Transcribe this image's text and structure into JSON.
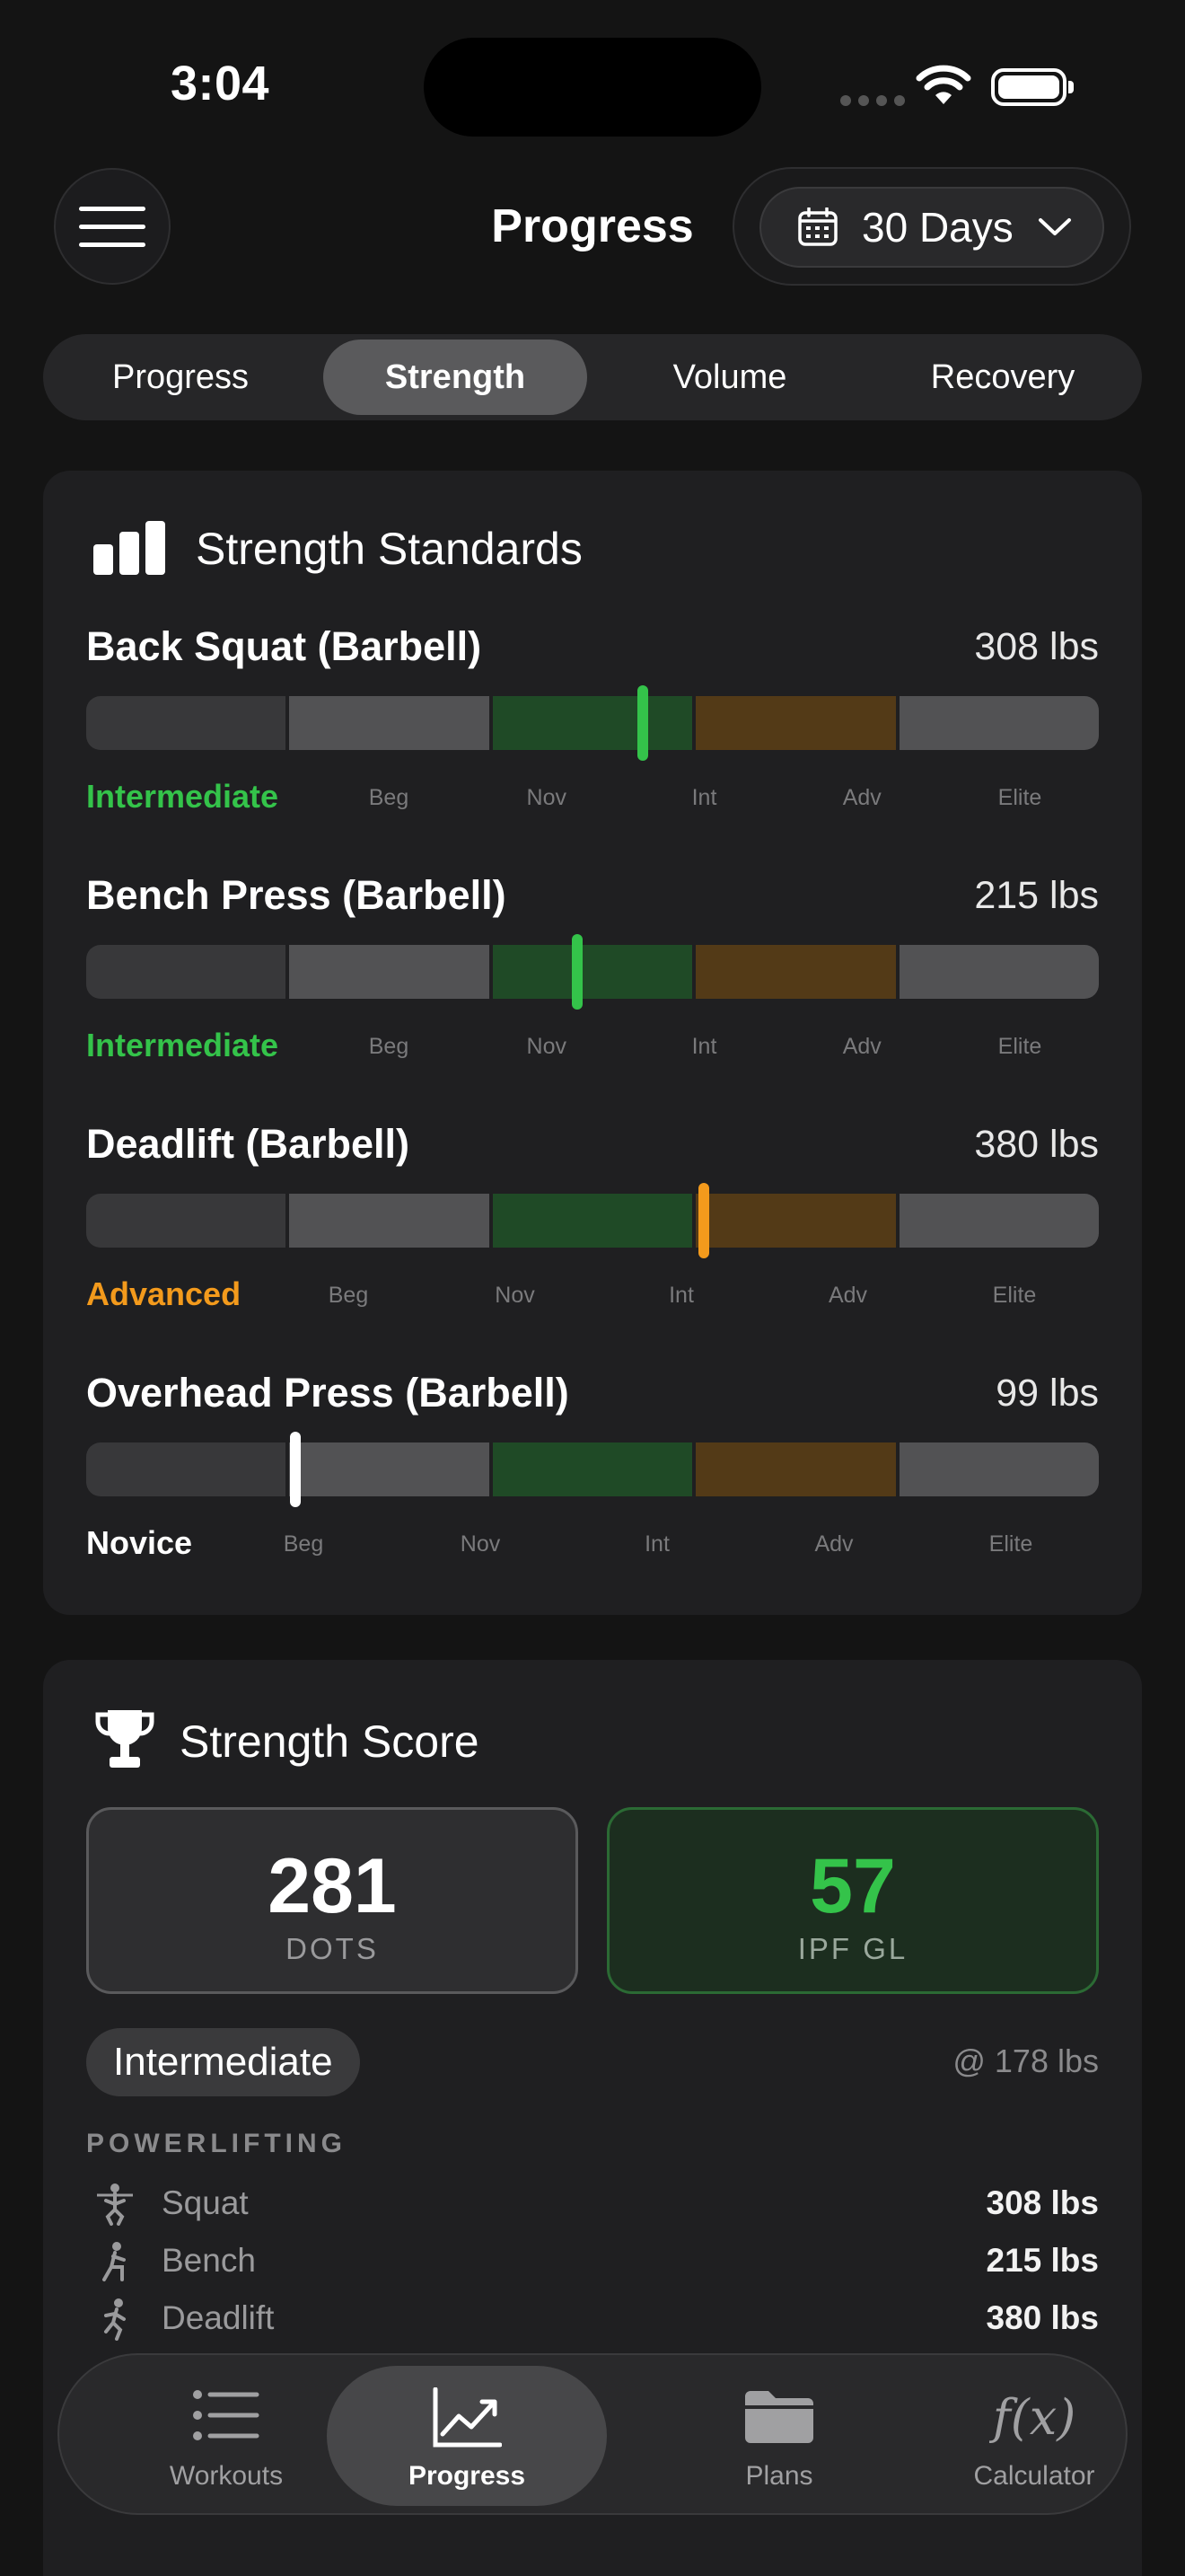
{
  "status": {
    "time": "3:04"
  },
  "header": {
    "title": "Progress",
    "range_label": "30 Days"
  },
  "segments": [
    {
      "label": "Progress",
      "active": false
    },
    {
      "label": "Strength",
      "active": true
    },
    {
      "label": "Volume",
      "active": false
    },
    {
      "label": "Recovery",
      "active": false
    }
  ],
  "standards": {
    "title": "Strength Standards",
    "lifts": [
      {
        "name": "Back Squat (Barbell)",
        "weight": "308 lbs",
        "level": "Intermediate",
        "level_color": "#34c34a",
        "marker_color": "#34c34a",
        "marker_position": 0.55,
        "ticks": [
          "Beg",
          "Nov",
          "Int",
          "Adv",
          "Elite"
        ]
      },
      {
        "name": "Bench Press (Barbell)",
        "weight": "215 lbs",
        "level": "Intermediate",
        "level_color": "#34c34a",
        "marker_color": "#34c34a",
        "marker_position": 0.485,
        "ticks": [
          "Beg",
          "Nov",
          "Int",
          "Adv",
          "Elite"
        ]
      },
      {
        "name": "Deadlift (Barbell)",
        "weight": "380 lbs",
        "level": "Advanced",
        "level_color": "#f39a1c",
        "marker_color": "#f39a1c",
        "marker_position": 0.61,
        "ticks": [
          "Beg",
          "Nov",
          "Int",
          "Adv",
          "Elite"
        ]
      },
      {
        "name": "Overhead Press (Barbell)",
        "weight": "99 lbs",
        "level": "Novice",
        "level_color": "#ffffff",
        "marker_color": "#ffffff",
        "marker_position": 0.207,
        "ticks": [
          "Beg",
          "Nov",
          "Int",
          "Adv",
          "Elite"
        ]
      }
    ],
    "segment_colors": [
      "#38383a",
      "#525254",
      "#1f4a26",
      "#533a17",
      "#525254"
    ]
  },
  "score": {
    "title": "Strength Score",
    "dots_value": "281",
    "dots_label": "DOTS",
    "ipf_value": "57",
    "ipf_label": "IPF GL",
    "classification": "Intermediate",
    "bodyweight": "@ 178 lbs",
    "section_label": "POWERLIFTING",
    "lifts": [
      {
        "name": "Squat",
        "value": "308 lbs",
        "icon": "squat-icon"
      },
      {
        "name": "Bench",
        "value": "215 lbs",
        "icon": "bench-icon"
      },
      {
        "name": "Deadlift",
        "value": "380 lbs",
        "icon": "deadlift-icon"
      }
    ]
  },
  "tabs": [
    {
      "label": "Workouts",
      "icon": "list-icon",
      "active": false
    },
    {
      "label": "Progress",
      "icon": "chart-line-icon",
      "active": true
    },
    {
      "label": "Plans",
      "icon": "folder-icon",
      "active": false
    },
    {
      "label": "Calculator",
      "icon": "function-icon",
      "active": false
    }
  ],
  "colors": {
    "background": "#141414",
    "card": "#1f1f21",
    "green": "#34c34a",
    "orange": "#f39a1c"
  }
}
